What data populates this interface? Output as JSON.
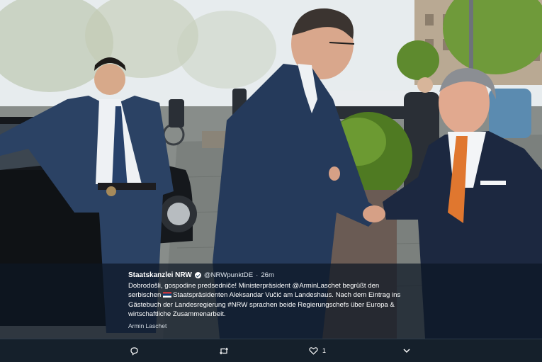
{
  "tweet": {
    "account_name": "Staatskanzlei NRW",
    "handle": "@NRWpunktDE",
    "separator": "·",
    "time": "26m",
    "text_line1_a": "Dobrodošli, gospodine predsedniče! Ministerpräsident ",
    "mention": "@ArminLaschet",
    "text_line1_b": " begrüßt den",
    "text_line2_a": "serbischen ",
    "text_line2_b": "Staatspräsidenten Aleksandar Vučić am Landeshaus. Nach dem Eintrag ins",
    "text_line3_a": "Gästebuch der Landesregierung ",
    "hashtag": "#NRW",
    "text_line3_b": " sprachen beide Regierungschefs über Europa &",
    "text_line4": "wirtschaftliche  Zusammenarbeit.",
    "photo_credit": "Armin Laschet"
  },
  "actions": {
    "reply_icon": "reply-icon",
    "retweet_icon": "retweet-icon",
    "like_icon": "heart-icon",
    "like_count": "1",
    "more_icon": "chevron-down-icon"
  },
  "colors": {
    "overlay": "#0c1624",
    "action_bar": "#15202b",
    "text": "#ffffff"
  }
}
